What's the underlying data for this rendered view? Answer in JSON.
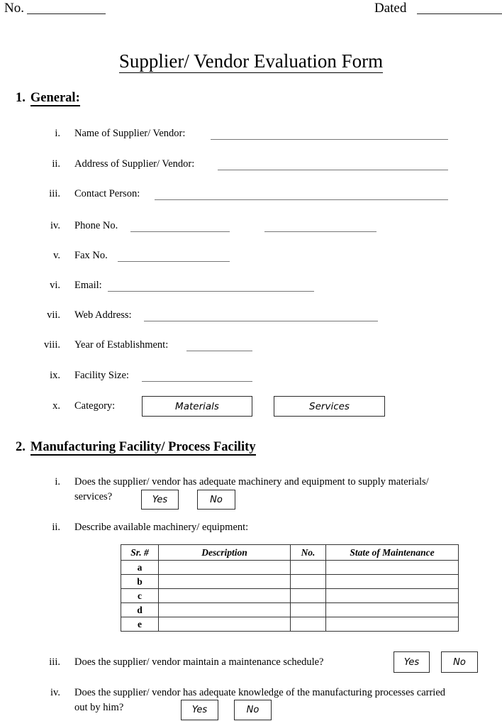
{
  "header": {
    "no_label": "No.",
    "dated_label": "Dated"
  },
  "title": "Supplier/ Vendor Evaluation Form",
  "sections": [
    {
      "number": "1.",
      "heading": "General:",
      "items": [
        {
          "numeral": "i.",
          "label": "Name of Supplier/ Vendor:"
        },
        {
          "numeral": "ii.",
          "label": "Address of Supplier/ Vendor:"
        },
        {
          "numeral": "iii.",
          "label": "Contact Person:"
        },
        {
          "numeral": "iv.",
          "label": "Phone No."
        },
        {
          "numeral": "v.",
          "label": "Fax No."
        },
        {
          "numeral": "vi.",
          "label": "Email:"
        },
        {
          "numeral": "vii.",
          "label": "Web Address:"
        },
        {
          "numeral": "viii.",
          "label": "Year of Establishment:"
        },
        {
          "numeral": "ix.",
          "label": "Facility Size:"
        },
        {
          "numeral": "x.",
          "label": "Category:"
        }
      ],
      "category_options": [
        "Materials",
        "Services"
      ]
    },
    {
      "number": "2.",
      "heading": "Manufacturing Facility/ Process Facility",
      "items": [
        {
          "numeral": "i.",
          "question": "Does the supplier/ vendor has adequate machinery and equipment to supply materials/ services?",
          "options": [
            "Yes",
            "No"
          ]
        },
        {
          "numeral": "ii.",
          "question": "Describe available machinery/ equipment:"
        },
        {
          "numeral": "iii.",
          "question": "Does the supplier/ vendor maintain a maintenance schedule?",
          "options": [
            "Yes",
            "No"
          ]
        },
        {
          "numeral": "iv.",
          "question": "Does the supplier/ vendor has adequate knowledge of the manufacturing processes carried out by him?",
          "options": [
            "Yes",
            "No"
          ]
        }
      ]
    }
  ],
  "machinery_table": {
    "headers": [
      "Sr. #",
      "Description",
      "No.",
      "State of Maintenance"
    ],
    "rows": [
      {
        "sr": "a",
        "description": "",
        "no": "",
        "state": ""
      },
      {
        "sr": "b",
        "description": "",
        "no": "",
        "state": ""
      },
      {
        "sr": "c",
        "description": "",
        "no": "",
        "state": ""
      },
      {
        "sr": "d",
        "description": "",
        "no": "",
        "state": ""
      },
      {
        "sr": "e",
        "description": "",
        "no": "",
        "state": ""
      }
    ]
  },
  "question_lines": {
    "sec2_i_line1": "Does  the  supplier/  vendor  has  adequate  machinery  and  equipment  to  supply  materials/",
    "sec2_i_line2": "services?",
    "sec2_iv_line1": "Does  the  supplier/  vendor  has  adequate  knowledge  of  the  manufacturing  processes  carried",
    "sec2_iv_line2": "out by him?"
  }
}
